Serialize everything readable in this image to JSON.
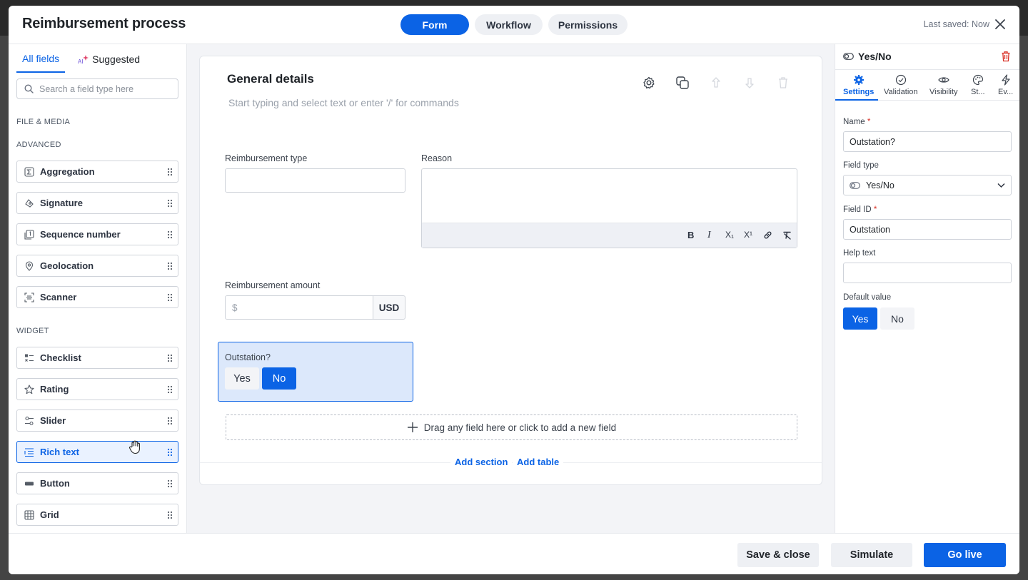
{
  "header": {
    "title": "Reimbursement process",
    "tabs": [
      {
        "label": "Form",
        "active": true
      },
      {
        "label": "Workflow",
        "active": false
      },
      {
        "label": "Permissions",
        "active": false
      }
    ],
    "last_saved": "Last saved: Now"
  },
  "left_panel": {
    "tabs": [
      {
        "label": "All fields",
        "active": true
      },
      {
        "label": "Suggested",
        "badge": "AI"
      }
    ],
    "search_placeholder": "Search a field type here",
    "sections": {
      "file_media": "FILE & MEDIA",
      "advanced": "ADVANCED",
      "widget": "WIDGET"
    },
    "advanced_items": [
      {
        "label": "Aggregation",
        "icon": "sigma-icon"
      },
      {
        "label": "Signature",
        "icon": "signature-icon"
      },
      {
        "label": "Sequence number",
        "icon": "sequence-icon"
      },
      {
        "label": "Geolocation",
        "icon": "location-pin-icon"
      },
      {
        "label": "Scanner",
        "icon": "scanner-icon"
      }
    ],
    "widget_items": [
      {
        "label": "Checklist",
        "icon": "checklist-icon"
      },
      {
        "label": "Rating",
        "icon": "star-icon"
      },
      {
        "label": "Slider",
        "icon": "slider-icon"
      },
      {
        "label": "Rich text",
        "icon": "rich-text-icon",
        "selected": true
      },
      {
        "label": "Button",
        "icon": "button-icon"
      },
      {
        "label": "Grid",
        "icon": "grid-icon"
      }
    ]
  },
  "canvas": {
    "section_title": "General details",
    "section_placeholder": "Start typing and select text or enter '/' for commands",
    "fields": {
      "reimbursement_type_label": "Reimbursement type",
      "reason_label": "Reason",
      "amount_label": "Reimbursement amount",
      "amount_prefix": "$",
      "amount_currency": "USD",
      "outstation_label": "Outstation?",
      "outstation_yes": "Yes",
      "outstation_no": "No",
      "outstation_value": "No"
    },
    "rich_text_toolbar": [
      "B",
      "I",
      "X₁",
      "X¹",
      "link",
      "clear-format"
    ],
    "dropzone_text": "Drag any field here or click to add a new field",
    "add_section": "Add section",
    "add_table": "Add table"
  },
  "right_panel": {
    "field_type_title": "Yes/No",
    "tabs": [
      {
        "label": "Settings",
        "icon": "gear-icon",
        "active": true
      },
      {
        "label": "Validation",
        "icon": "check-circle-icon"
      },
      {
        "label": "Visibility",
        "icon": "eye-icon"
      },
      {
        "label": "St...",
        "icon": "palette-icon"
      },
      {
        "label": "Ev...",
        "icon": "bolt-icon"
      }
    ],
    "name_label": "Name",
    "name_value": "Outstation?",
    "field_type_label": "Field type",
    "field_type_value": "Yes/No",
    "field_id_label": "Field ID",
    "field_id_value": "Outstation",
    "help_text_label": "Help text",
    "help_text_value": "",
    "default_value_label": "Default value",
    "default_yes": "Yes",
    "default_no": "No",
    "default_selected": "Yes",
    "required_mark": "*"
  },
  "footer": {
    "save_close": "Save & close",
    "simulate": "Simulate",
    "go_live": "Go live"
  },
  "colors": {
    "primary": "#0b63e5",
    "selected_bg": "#dce8fb",
    "danger": "#d93025"
  }
}
